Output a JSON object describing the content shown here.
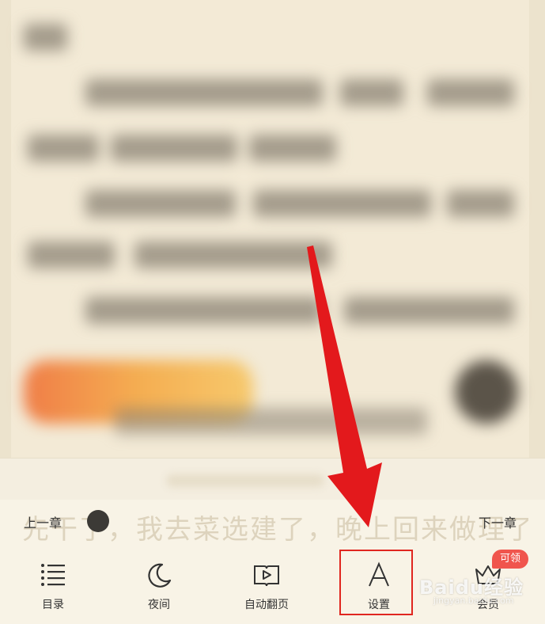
{
  "reader": {
    "ghost_sentence": "先干了，我去菜选建了，晚上回来做理了"
  },
  "chapter_nav": {
    "prev_label": "上一章",
    "next_label": "下一章",
    "progress": 0.0
  },
  "toolbar": {
    "items": [
      {
        "label": "目录",
        "icon": "list-icon"
      },
      {
        "label": "夜间",
        "icon": "moon-icon"
      },
      {
        "label": "自动翻页",
        "icon": "auto-page-icon"
      },
      {
        "label": "设置",
        "icon": "font-a-icon"
      },
      {
        "label": "会员",
        "icon": "crown-icon"
      }
    ],
    "vip_badge": "可领"
  },
  "watermark": {
    "text": "Baidu经验",
    "sub": "jingyan.baidu.com"
  },
  "colors": {
    "highlight": "#e0261f",
    "badge": "#f0554d",
    "panel": "#f8f3e6"
  }
}
